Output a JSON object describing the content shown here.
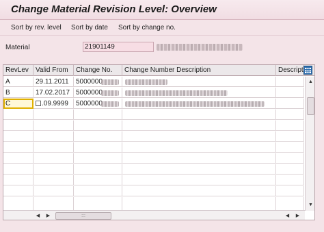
{
  "window": {
    "title": "Change Material Revision Level: Overview"
  },
  "toolbar": {
    "sort_rev": "Sort by rev. level",
    "sort_date": "Sort by date",
    "sort_change": "Sort by change no."
  },
  "material": {
    "label": "Material",
    "value": "21901149"
  },
  "table": {
    "columns": [
      "RevLev",
      "Valid From",
      "Change No.",
      "Change Number Description",
      "Descripti"
    ],
    "rows": [
      {
        "revlev": "A",
        "valid_from": "29.11.2011",
        "change_no": "5000000"
      },
      {
        "revlev": "B",
        "valid_from": "17.02.2017",
        "change_no": "5000000"
      },
      {
        "revlev": "C",
        "valid_from": ".09.9999",
        "change_no": "5000000"
      }
    ]
  },
  "scroll": {
    "hthumb_label": ":::"
  },
  "icons": {
    "config": "table-settings-icon",
    "up": "arrow-up-icon",
    "down": "arrow-down-icon",
    "left": "arrow-left-icon",
    "right": "arrow-right-icon"
  },
  "colors": {
    "background": "#f4e4e8",
    "input": "#f7dde4",
    "selection": "#e0b000"
  }
}
